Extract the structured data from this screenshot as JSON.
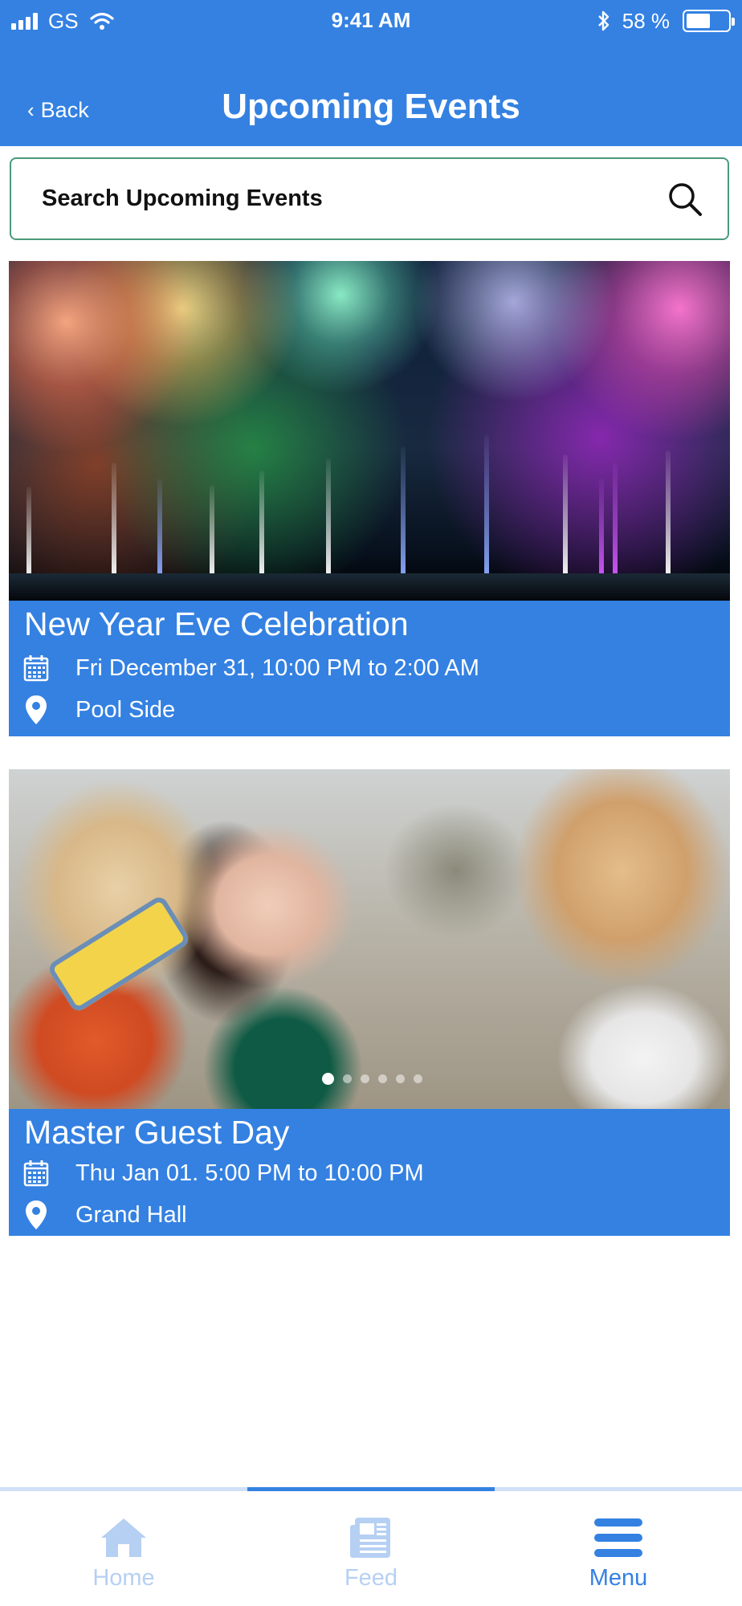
{
  "status_bar": {
    "carrier": "GS",
    "time": "9:41 AM",
    "battery_percent": "58 %",
    "battery_level": 0.58
  },
  "nav": {
    "back_label": "Back",
    "title": "Upcoming Events"
  },
  "search": {
    "placeholder": "Search Upcoming Events"
  },
  "events": [
    {
      "title": "New Year Eve Celebration",
      "date": "Fri December 31, 10:00 PM to 2:00 AM",
      "location": "Pool Side",
      "image": "fireworks-photo"
    },
    {
      "title": "Master Guest Day",
      "date": "Thu Jan 01. 5:00 PM to 10:00 PM",
      "location": "Grand Hall",
      "image": "party-guests-photo",
      "carousel_total": 6,
      "carousel_active": 1
    }
  ],
  "tabs": [
    {
      "label": "Home",
      "icon": "home-icon",
      "state": "inactive"
    },
    {
      "label": "Feed",
      "icon": "feed-icon",
      "state": "inactive"
    },
    {
      "label": "Menu",
      "icon": "menu-icon",
      "state": "active"
    }
  ],
  "colors": {
    "brand_blue": "#3481e2",
    "search_border": "#4a9a7b",
    "tab_inactive": "#b6d0f3"
  }
}
